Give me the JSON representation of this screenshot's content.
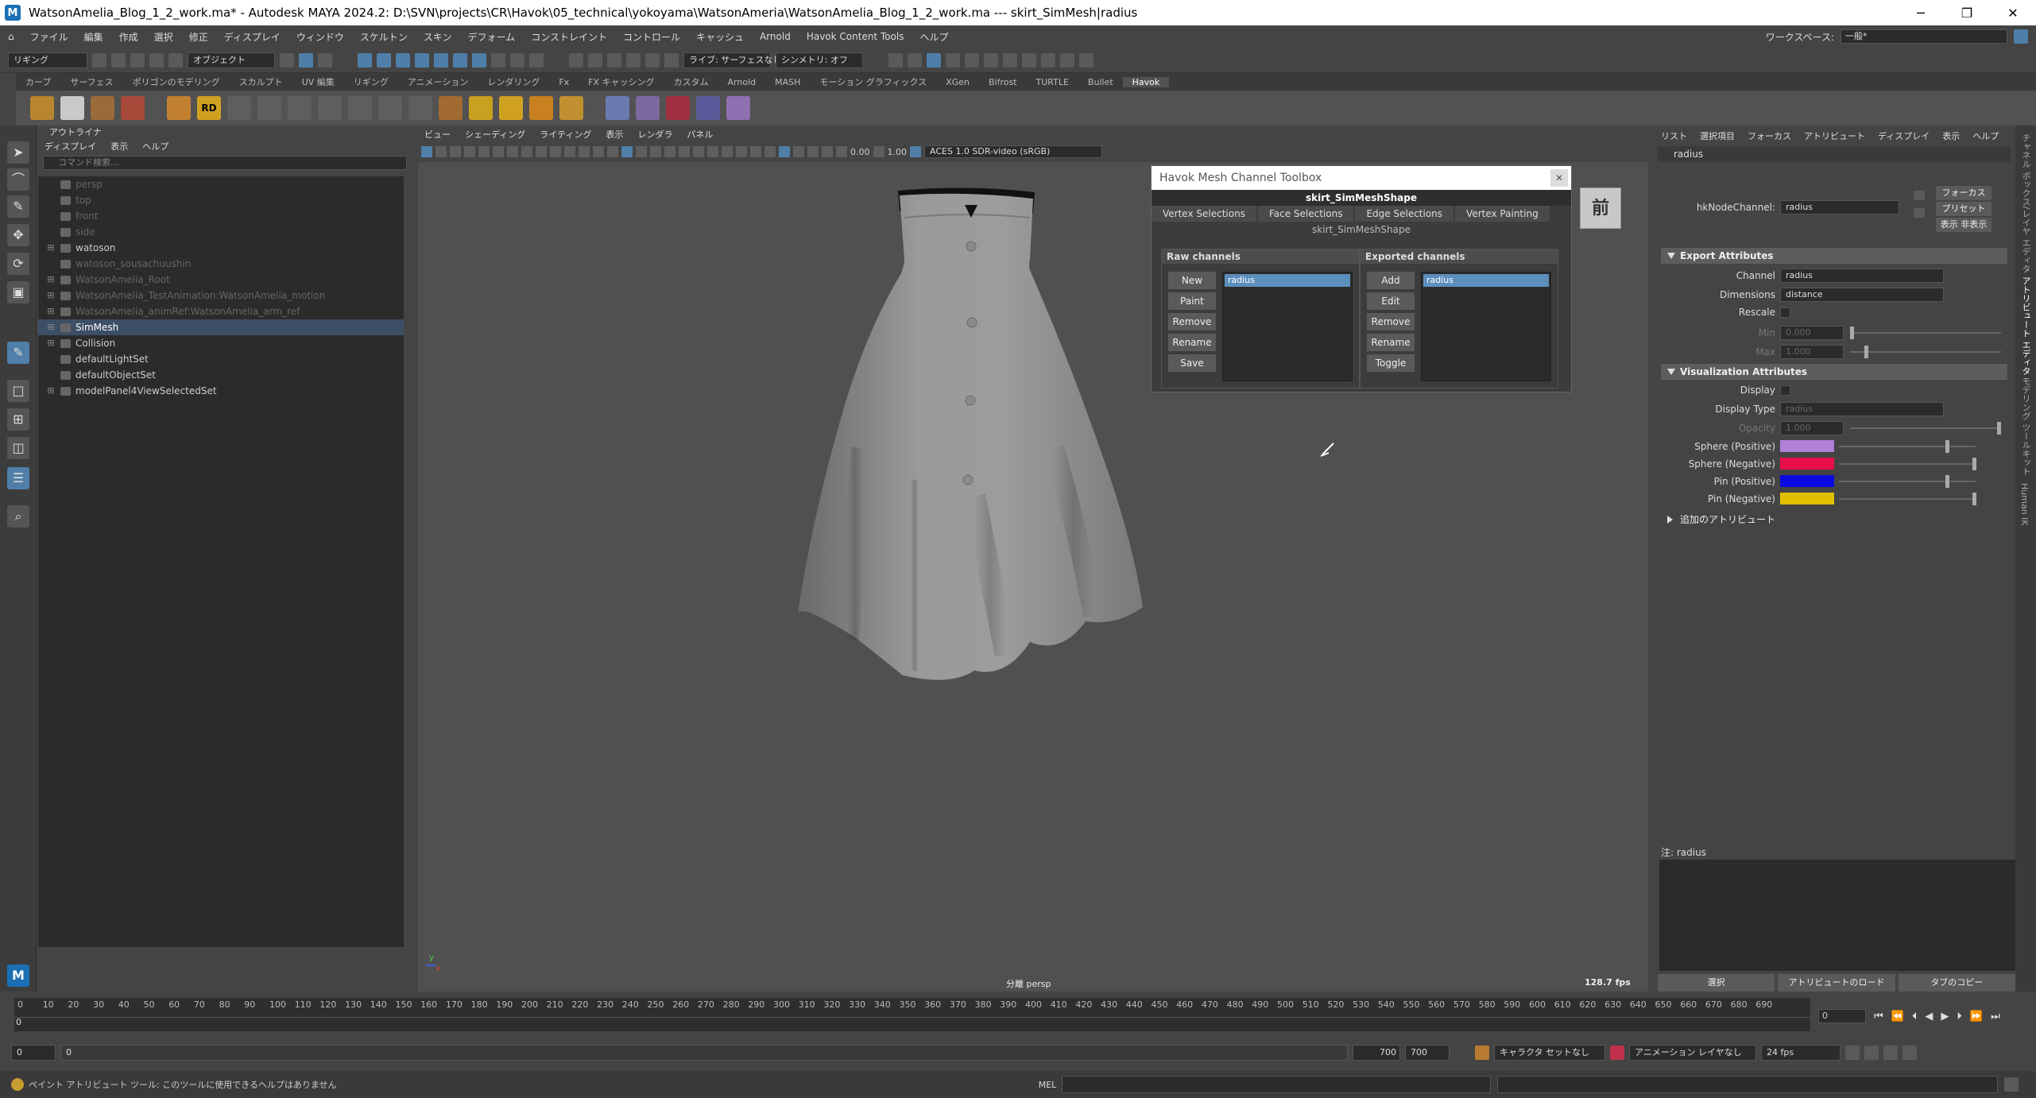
{
  "window": {
    "title": "WatsonAmelia_Blog_1_2_work.ma* - Autodesk MAYA 2024.2: D:\\SVN\\projects\\CR\\Havok\\05_technical\\yokoyama\\WatsonAmeria\\WatsonAmelia_Blog_1_2_work.ma  ---  skirt_SimMesh|radius",
    "controls": [
      "─",
      "❐",
      "✕"
    ]
  },
  "menubar": {
    "items": [
      "ファイル",
      "編集",
      "作成",
      "選択",
      "修正",
      "ディスプレイ",
      "ウィンドウ",
      "スケルトン",
      "スキン",
      "デフォーム",
      "コンストレイント",
      "コントロール",
      "キャッシュ",
      "Arnold",
      "Havok Content Tools",
      "ヘルプ"
    ],
    "workspace_label": "ワークスペース:",
    "workspace_value": "一般*"
  },
  "statusline": {
    "mode": "リギング",
    "object": "オブジェクト",
    "live": "ライブ: サーフェスなし",
    "symmetry": "シンメトリ: オフ"
  },
  "shelf": {
    "tabs": [
      "カーブ",
      "サーフェス",
      "ポリゴンのモデリング",
      "スカルプト",
      "UV 編集",
      "リギング",
      "アニメーション",
      "レンダリング",
      "Fx",
      "FX キャッシング",
      "カスタム",
      "Arnold",
      "MASH",
      "モーション グラフィックス",
      "XGen",
      "Bifrost",
      "TURTLE",
      "Bullet",
      "Havok"
    ],
    "active": "Havok",
    "badge": "RD"
  },
  "outliner": {
    "title": "アウトライナ",
    "menu": [
      "ディスプレイ",
      "表示",
      "ヘルプ"
    ],
    "search_placeholder": "コマンド検索...",
    "rows": [
      {
        "label": "persp",
        "dim": true,
        "exp": ""
      },
      {
        "label": "top",
        "dim": true,
        "exp": ""
      },
      {
        "label": "front",
        "dim": true,
        "exp": ""
      },
      {
        "label": "side",
        "dim": true,
        "exp": ""
      },
      {
        "label": "watoson",
        "dim": false,
        "exp": "⊞"
      },
      {
        "label": "watoson_sousachuushin",
        "dim": true,
        "exp": ""
      },
      {
        "label": "WatsonAmelia_Root",
        "dim": true,
        "exp": "⊞"
      },
      {
        "label": "WatsonAmelia_TestAnimation:WatsonAmelia_motion",
        "dim": true,
        "exp": "⊞"
      },
      {
        "label": "WatsonAmelia_animRef:WatsonAmelia_arm_ref",
        "dim": true,
        "exp": "⊞"
      },
      {
        "label": "SimMesh",
        "dim": false,
        "exp": "⊞",
        "selected": true
      },
      {
        "label": "Collision",
        "dim": false,
        "exp": "⊞"
      },
      {
        "label": "defaultLightSet",
        "dim": false,
        "exp": ""
      },
      {
        "label": "defaultObjectSet",
        "dim": false,
        "exp": ""
      },
      {
        "label": "modelPanel4ViewSelectedSet",
        "dim": false,
        "exp": "⊞"
      }
    ]
  },
  "viewport": {
    "menu": [
      "ビュー",
      "シェーディング",
      "ライティング",
      "表示",
      "レンダラ",
      "パネル"
    ],
    "exposure": "0.00",
    "gamma": "1.00",
    "colorspace": "ACES 1.0 SDR-video (sRGB)",
    "camera": "persp",
    "camera_prefix": "分離",
    "fps": "128.7 fps",
    "viewcube": "前",
    "axis_y": "y",
    "axis_x": "x"
  },
  "toolbox": {
    "title": "Havok Mesh Channel Toolbox",
    "shape": "skirt_SimMeshShape",
    "tabs": [
      "Vertex Selections",
      "Face Selections",
      "Edge Selections",
      "Vertex Painting"
    ],
    "sub": "skirt_SimMeshShape",
    "raw": {
      "title": "Raw channels",
      "buttons": [
        "New",
        "Paint",
        "Remove",
        "Rename",
        "Save"
      ],
      "items": [
        "radius"
      ]
    },
    "exported": {
      "title": "Exported channels",
      "buttons": [
        "Add",
        "Edit",
        "Remove",
        "Rename",
        "Toggle"
      ],
      "items": [
        "radius"
      ]
    }
  },
  "attribute_editor": {
    "menu": [
      "リスト",
      "選択項目",
      "フォーカス",
      "アトリビュート",
      "ディスプレイ",
      "表示",
      "ヘルプ"
    ],
    "tab": "radius",
    "node_label": "hkNodeChannel:",
    "node_value": "radius",
    "focus_btn": "フォーカス",
    "preset_btn": "プリセット",
    "show_hide": "表示  非表示",
    "export_section": "Export Attributes",
    "channel_label": "Channel",
    "channel_value": "radius",
    "dimensions_label": "Dimensions",
    "dimensions_value": "distance",
    "rescale_label": "Rescale",
    "min_label": "Min",
    "min_value": "0.000",
    "max_label": "Max",
    "max_value": "1.000",
    "vis_section": "Visualization Attributes",
    "display_label": "Display",
    "display_type_label": "Display Type",
    "display_type_value": "radius",
    "opacity_label": "Opacity",
    "opacity_value": "1.000",
    "colors": [
      {
        "label": "Sphere (Positive)",
        "color": "#b07fd8",
        "level": 0.8
      },
      {
        "label": "Sphere (Negative)",
        "color": "#e8104a",
        "level": 1.0
      },
      {
        "label": "Pin (Positive)",
        "color": "#0a0ae0",
        "level": 0.8
      },
      {
        "label": "Pin (Negative)",
        "color": "#e0c000",
        "level": 1.0
      }
    ],
    "extra_section": "追加のアトリビュート",
    "notes_label": "注: radius",
    "bottom_buttons": [
      "選択",
      "アトリビュートのロード",
      "タブのコピー"
    ]
  },
  "right_strip": [
    "チャネル ボックス/レイヤ エディタ",
    "アトリビュート エディタ",
    "モデリング ツールキット",
    "Human IK"
  ],
  "timeline": {
    "ticks": [
      "0",
      "10",
      "20",
      "30",
      "40",
      "50",
      "60",
      "70",
      "80",
      "90",
      "100",
      "110",
      "120",
      "130",
      "140",
      "150",
      "160",
      "170",
      "180",
      "190",
      "200",
      "210",
      "220",
      "230",
      "240",
      "250",
      "260",
      "270",
      "280",
      "290",
      "300",
      "310",
      "320",
      "330",
      "340",
      "350",
      "360",
      "370",
      "380",
      "390",
      "400",
      "410",
      "420",
      "430",
      "440",
      "450",
      "460",
      "470",
      "480",
      "490",
      "500",
      "510",
      "520",
      "530",
      "540",
      "550",
      "560",
      "570",
      "580",
      "590",
      "600",
      "610",
      "620",
      "630",
      "640",
      "650",
      "660",
      "670",
      "680",
      "690"
    ],
    "current": "0",
    "current_frame_field": "0"
  },
  "range": {
    "start": "0",
    "start_inner": "0",
    "end_inner": "700",
    "end": "700",
    "character": "キャラクタ セットなし",
    "anim_layer": "アニメーション レイヤなし",
    "fps": "24 fps"
  },
  "cmdline": {
    "help": "ペイント アトリビュート ツール: このツールに使用できるヘルプはありません",
    "mel": "MEL"
  }
}
